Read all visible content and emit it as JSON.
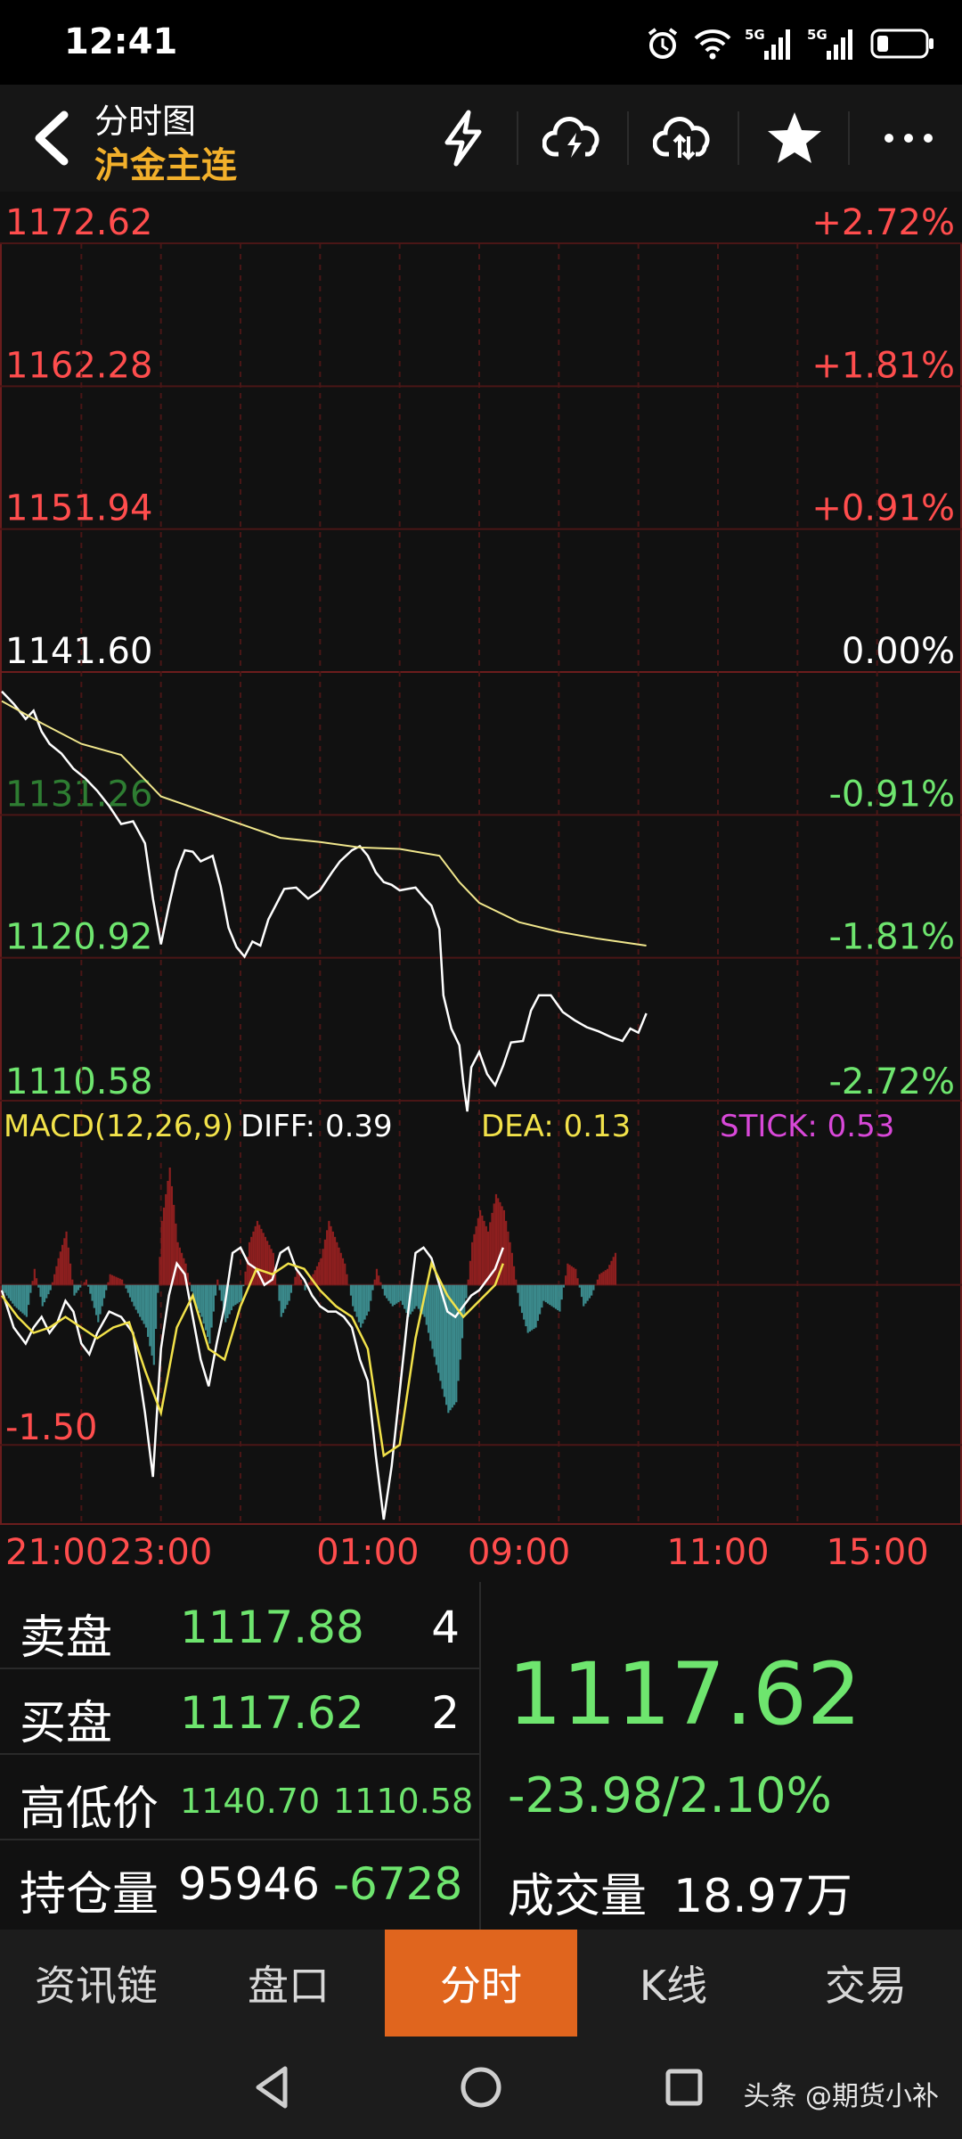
{
  "status_bar": {
    "time": "12:41",
    "icons": [
      "alarm-icon",
      "wifi-icon",
      "5g-signal-icon",
      "5g-signal-icon",
      "battery-icon"
    ]
  },
  "header": {
    "title": "分时图",
    "subtitle": "沪金主连",
    "actions": [
      "flash-icon",
      "cloud-lightning-icon",
      "cloud-sync-icon",
      "star-icon",
      "more-icon"
    ]
  },
  "chart_data": [
    {
      "type": "line",
      "title": "",
      "price_levels": [
        "1172.62",
        "1162.28",
        "1151.94",
        "1141.60",
        "1131.26",
        "1120.92",
        "1110.58"
      ],
      "percent_levels": [
        "+2.72%",
        "+1.81%",
        "+0.91%",
        "0.00%",
        "-0.91%",
        "-1.81%",
        "-2.72%"
      ],
      "reference_price": 1141.6,
      "ylim": [
        1110.58,
        1172.62
      ],
      "x_ticks": [
        "21:00",
        "23:00",
        "01:00",
        "09:00",
        "11:00",
        "15:00"
      ],
      "series": [
        {
          "color": "#ffffff",
          "points": [
            [
              0,
              1140.2
            ],
            [
              3,
              1139.3
            ],
            [
              6,
              1138.2
            ],
            [
              8,
              1138.8
            ],
            [
              10,
              1137.3
            ],
            [
              12,
              1136.4
            ],
            [
              15,
              1135.7
            ],
            [
              18,
              1134.6
            ],
            [
              21,
              1133.9
            ],
            [
              24,
              1133.0
            ],
            [
              27,
              1131.9
            ],
            [
              30,
              1130.6
            ],
            [
              33,
              1130.8
            ],
            [
              36,
              1129.2
            ],
            [
              38,
              1125.2
            ],
            [
              40,
              1121.9
            ],
            [
              42,
              1124.7
            ],
            [
              44,
              1127.2
            ],
            [
              46,
              1128.7
            ],
            [
              48,
              1128.6
            ],
            [
              50,
              1127.9
            ],
            [
              53,
              1128.3
            ],
            [
              55,
              1126.1
            ],
            [
              57,
              1123.1
            ],
            [
              59,
              1121.7
            ],
            [
              61,
              1121.0
            ],
            [
              63,
              1122.1
            ],
            [
              65,
              1121.8
            ],
            [
              67,
              1123.7
            ],
            [
              69,
              1124.8
            ],
            [
              71,
              1125.9
            ],
            [
              74,
              1126.0
            ],
            [
              77,
              1125.2
            ],
            [
              80,
              1125.8
            ],
            [
              83,
              1127.1
            ],
            [
              85,
              1127.9
            ],
            [
              88,
              1128.7
            ],
            [
              90,
              1129.0
            ],
            [
              92,
              1128.3
            ],
            [
              94,
              1127.1
            ],
            [
              96,
              1126.4
            ],
            [
              98,
              1126.2
            ],
            [
              100,
              1125.8
            ],
            [
              102,
              1125.9
            ],
            [
              104,
              1126.0
            ],
            [
              106,
              1125.3
            ],
            [
              108,
              1124.7
            ],
            [
              110,
              1123.0
            ],
            [
              111,
              1118.2
            ],
            [
              113,
              1115.8
            ],
            [
              115,
              1114.6
            ],
            [
              116,
              1111.9
            ],
            [
              117,
              1109.8
            ],
            [
              118,
              1113.0
            ],
            [
              120,
              1114.1
            ],
            [
              122,
              1112.5
            ],
            [
              124,
              1111.7
            ],
            [
              126,
              1113.1
            ],
            [
              128,
              1114.8
            ],
            [
              131,
              1114.9
            ],
            [
              133,
              1117.1
            ],
            [
              135,
              1118.2
            ],
            [
              138,
              1118.2
            ],
            [
              141,
              1117.0
            ],
            [
              144,
              1116.4
            ],
            [
              147,
              1115.9
            ],
            [
              150,
              1115.6
            ],
            [
              153,
              1115.2
            ],
            [
              156,
              1114.9
            ],
            [
              158,
              1115.8
            ],
            [
              160,
              1115.5
            ],
            [
              162,
              1116.9
            ]
          ]
        },
        {
          "color": "#f0e68c",
          "points": [
            [
              0,
              1139.5
            ],
            [
              10,
              1137.9
            ],
            [
              20,
              1136.4
            ],
            [
              30,
              1135.6
            ],
            [
              40,
              1132.6
            ],
            [
              50,
              1131.6
            ],
            [
              60,
              1130.6
            ],
            [
              70,
              1129.6
            ],
            [
              80,
              1129.3
            ],
            [
              90,
              1128.9
            ],
            [
              100,
              1128.8
            ],
            [
              110,
              1128.3
            ],
            [
              115,
              1126.4
            ],
            [
              120,
              1124.9
            ],
            [
              130,
              1123.5
            ],
            [
              140,
              1122.8
            ],
            [
              150,
              1122.3
            ],
            [
              162,
              1121.8
            ]
          ]
        }
      ]
    },
    {
      "type": "bar",
      "title": "MACD(12,26,9)",
      "legend": [
        {
          "label": "MACD(12,26,9)",
          "color": "#f2e24a"
        },
        {
          "label": "DIFF: 0.39",
          "color": "#ffffff"
        },
        {
          "label": "DEA: 0.13",
          "color": "#f2e24a"
        },
        {
          "label": "STICK: 0.53",
          "color": "#d948d9"
        }
      ],
      "y_tick": "-1.50",
      "ylim": [
        -2.2,
        1.1
      ],
      "stick_colors": {
        "positive": "#8e1f1f",
        "negative": "#3b8a8c"
      },
      "stick": [
        [
          0,
          -0.05
        ],
        [
          3,
          -0.2
        ],
        [
          6,
          -0.3
        ],
        [
          8,
          0.15
        ],
        [
          10,
          -0.2
        ],
        [
          12,
          -0.05
        ],
        [
          14,
          0.25
        ],
        [
          16,
          0.5
        ],
        [
          18,
          -0.1
        ],
        [
          21,
          0.05
        ],
        [
          24,
          -0.35
        ],
        [
          27,
          0.1
        ],
        [
          30,
          0.05
        ],
        [
          33,
          -0.2
        ],
        [
          36,
          -0.4
        ],
        [
          38,
          -0.75
        ],
        [
          40,
          0.6
        ],
        [
          42,
          1.1
        ],
        [
          44,
          0.4
        ],
        [
          46,
          0.2
        ],
        [
          48,
          -0.15
        ],
        [
          50,
          -0.3
        ],
        [
          52,
          -0.55
        ],
        [
          54,
          0.05
        ],
        [
          56,
          -0.35
        ],
        [
          58,
          -0.2
        ],
        [
          60,
          -0.15
        ],
        [
          62,
          0.4
        ],
        [
          64,
          0.6
        ],
        [
          66,
          0.45
        ],
        [
          68,
          0.3
        ],
        [
          70,
          -0.3
        ],
        [
          72,
          -0.15
        ],
        [
          74,
          0.15
        ],
        [
          76,
          -0.05
        ],
        [
          78,
          0.1
        ],
        [
          80,
          0.25
        ],
        [
          82,
          0.6
        ],
        [
          84,
          0.4
        ],
        [
          86,
          0.2
        ],
        [
          88,
          -0.2
        ],
        [
          90,
          -0.4
        ],
        [
          92,
          -0.25
        ],
        [
          94,
          0.15
        ],
        [
          96,
          -0.1
        ],
        [
          98,
          -0.2
        ],
        [
          100,
          -0.15
        ],
        [
          102,
          -0.3
        ],
        [
          104,
          -0.2
        ],
        [
          106,
          -0.3
        ],
        [
          108,
          -0.6
        ],
        [
          110,
          -0.9
        ],
        [
          112,
          -1.2
        ],
        [
          114,
          -1.1
        ],
        [
          116,
          -0.3
        ],
        [
          118,
          0.4
        ],
        [
          120,
          0.7
        ],
        [
          122,
          0.5
        ],
        [
          124,
          0.85
        ],
        [
          126,
          0.7
        ],
        [
          128,
          0.3
        ],
        [
          130,
          -0.2
        ],
        [
          132,
          -0.45
        ],
        [
          134,
          -0.4
        ],
        [
          136,
          -0.15
        ],
        [
          138,
          -0.2
        ],
        [
          140,
          -0.25
        ],
        [
          142,
          0.2
        ],
        [
          144,
          0.15
        ],
        [
          146,
          -0.2
        ],
        [
          148,
          -0.1
        ],
        [
          150,
          0.1
        ],
        [
          152,
          0.15
        ],
        [
          154,
          0.3
        ]
      ],
      "series": [
        {
          "name": "DIFF",
          "color": "#ffffff",
          "points": [
            [
              0,
              -0.05
            ],
            [
              3,
              -0.4
            ],
            [
              6,
              -0.55
            ],
            [
              8,
              -0.4
            ],
            [
              10,
              -0.3
            ],
            [
              12,
              -0.45
            ],
            [
              14,
              -0.35
            ],
            [
              16,
              -0.15
            ],
            [
              18,
              -0.25
            ],
            [
              20,
              -0.55
            ],
            [
              22,
              -0.65
            ],
            [
              24,
              -0.45
            ],
            [
              27,
              -0.25
            ],
            [
              30,
              -0.3
            ],
            [
              33,
              -0.45
            ],
            [
              36,
              -1.2
            ],
            [
              38,
              -1.8
            ],
            [
              40,
              -0.6
            ],
            [
              42,
              -0.1
            ],
            [
              44,
              0.2
            ],
            [
              46,
              0.1
            ],
            [
              48,
              -0.3
            ],
            [
              50,
              -0.7
            ],
            [
              52,
              -0.95
            ],
            [
              54,
              -0.55
            ],
            [
              56,
              -0.2
            ],
            [
              58,
              0.3
            ],
            [
              60,
              0.35
            ],
            [
              62,
              0.2
            ],
            [
              64,
              0.15
            ],
            [
              66,
              0.0
            ],
            [
              68,
              0.05
            ],
            [
              70,
              0.3
            ],
            [
              72,
              0.35
            ],
            [
              74,
              0.15
            ],
            [
              76,
              0.05
            ],
            [
              78,
              -0.1
            ],
            [
              80,
              -0.2
            ],
            [
              82,
              -0.25
            ],
            [
              84,
              -0.25
            ],
            [
              86,
              -0.3
            ],
            [
              88,
              -0.4
            ],
            [
              90,
              -0.7
            ],
            [
              92,
              -0.9
            ],
            [
              94,
              -1.6
            ],
            [
              96,
              -2.2
            ],
            [
              98,
              -1.7
            ],
            [
              100,
              -1.0
            ],
            [
              102,
              -0.3
            ],
            [
              104,
              0.3
            ],
            [
              106,
              0.35
            ],
            [
              108,
              0.25
            ],
            [
              110,
              0.0
            ],
            [
              112,
              -0.25
            ],
            [
              114,
              -0.3
            ],
            [
              116,
              -0.2
            ],
            [
              118,
              -0.1
            ],
            [
              120,
              -0.05
            ],
            [
              122,
              0.05
            ],
            [
              124,
              0.15
            ],
            [
              126,
              0.35
            ]
          ]
        },
        {
          "name": "DEA",
          "color": "#f2e24a",
          "points": [
            [
              0,
              -0.1
            ],
            [
              4,
              -0.3
            ],
            [
              8,
              -0.45
            ],
            [
              12,
              -0.4
            ],
            [
              16,
              -0.3
            ],
            [
              20,
              -0.4
            ],
            [
              24,
              -0.5
            ],
            [
              28,
              -0.4
            ],
            [
              32,
              -0.35
            ],
            [
              36,
              -0.8
            ],
            [
              40,
              -1.2
            ],
            [
              44,
              -0.4
            ],
            [
              48,
              -0.1
            ],
            [
              52,
              -0.6
            ],
            [
              56,
              -0.7
            ],
            [
              60,
              -0.2
            ],
            [
              64,
              0.15
            ],
            [
              68,
              0.1
            ],
            [
              72,
              0.2
            ],
            [
              76,
              0.15
            ],
            [
              80,
              -0.05
            ],
            [
              84,
              -0.2
            ],
            [
              88,
              -0.3
            ],
            [
              92,
              -0.6
            ],
            [
              96,
              -1.6
            ],
            [
              100,
              -1.5
            ],
            [
              104,
              -0.5
            ],
            [
              108,
              0.2
            ],
            [
              112,
              -0.1
            ],
            [
              116,
              -0.3
            ],
            [
              120,
              -0.15
            ],
            [
              124,
              0.0
            ],
            [
              126,
              0.2
            ]
          ]
        }
      ]
    }
  ],
  "info_panel": {
    "sell_label": "卖盘",
    "sell_price": "1117.88",
    "sell_qty": "4",
    "buy_label": "买盘",
    "buy_price": "1117.62",
    "buy_qty": "2",
    "hilo_label": "高低价",
    "high": "1140.70",
    "low": "1110.58",
    "oi_label": "持仓量",
    "oi": "95946",
    "oi_change": "-6728",
    "last_price": "1117.62",
    "change": "-23.98/2.10%",
    "volume_label": "成交量",
    "volume": "18.97万"
  },
  "tabs": [
    {
      "label": "资讯链",
      "active": false
    },
    {
      "label": "盘口",
      "active": false
    },
    {
      "label": "分时",
      "active": true
    },
    {
      "label": "K线",
      "active": false
    },
    {
      "label": "交易",
      "active": false
    }
  ],
  "navbar": {
    "watermark": "头条 @期货小补"
  }
}
